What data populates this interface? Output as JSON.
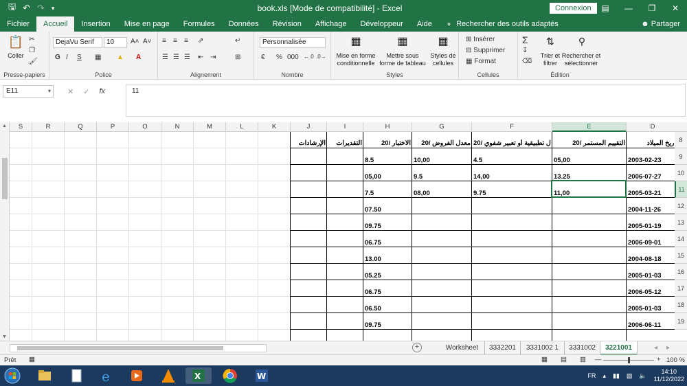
{
  "titlebar": {
    "title": "book.xls  [Mode de compatibilité]  -  Excel",
    "signin": "Connexion"
  },
  "ribbon_tabs": [
    "Fichier",
    "Accueil",
    "Insertion",
    "Mise en page",
    "Formules",
    "Données",
    "Révision",
    "Affichage",
    "Développeur",
    "Aide"
  ],
  "tell_me": "Rechercher des outils adaptés",
  "share": "Partager",
  "ribbon": {
    "clipboard": {
      "paste": "Coller",
      "label": "Presse-papiers"
    },
    "font": {
      "name": "DejaVu Serif",
      "size": "10",
      "label": "Police"
    },
    "alignment": {
      "label": "Alignement"
    },
    "number": {
      "format": "Personnalisée",
      "label": "Nombre"
    },
    "styles": {
      "conditional": "Mise en forme conditionnelle",
      "table": "Mettre sous forme de tableau",
      "cell_styles": "Styles de cellules",
      "label": "Styles"
    },
    "cells": {
      "insert": "Insérer",
      "delete": "Supprimer",
      "format": "Format",
      "label": "Cellules"
    },
    "editing": {
      "sort": "Trier et filtrer",
      "find": "Rechercher et sélectionner",
      "label": "Édition"
    }
  },
  "formula_bar": {
    "name_box": "E11",
    "value": "11"
  },
  "columns": [
    "S",
    "R",
    "Q",
    "P",
    "O",
    "N",
    "M",
    "L",
    "K",
    "J",
    "I",
    "H",
    "G",
    "F",
    "E",
    "D"
  ],
  "rows": [
    "8",
    "9",
    "10",
    "11",
    "12",
    "13",
    "14",
    "15",
    "16",
    "17",
    "18",
    "19"
  ],
  "headers": {
    "D": "تاريخ الميلاد",
    "E": "التقييم المستمر /20",
    "F": "أعمال تطبيقية أو تعبير شفوي /20",
    "G": "معدل الفروض /20",
    "H": "الاختبار /20",
    "I": "التقديرات",
    "J": "الإرشادات"
  },
  "table_rows": [
    {
      "D": "2003-02-23",
      "E": "05,00",
      "F": "4.5",
      "G": "10,00",
      "H": "8.5"
    },
    {
      "D": "2006-07-27",
      "E": "13.25",
      "F": "14,00",
      "G": "9.5",
      "H": "05,00"
    },
    {
      "D": "2005-03-21",
      "E": "11,00",
      "F": "9.75",
      "G": "08,00",
      "H": "7.5"
    },
    {
      "D": "2004-11-26",
      "E": "",
      "F": "",
      "G": "",
      "H": "07.50"
    },
    {
      "D": "2005-01-19",
      "E": "",
      "F": "",
      "G": "",
      "H": "09.75"
    },
    {
      "D": "2006-09-01",
      "E": "",
      "F": "",
      "G": "",
      "H": "06.75"
    },
    {
      "D": "2004-08-18",
      "E": "",
      "F": "",
      "G": "",
      "H": "13.00"
    },
    {
      "D": "2005-01-03",
      "E": "",
      "F": "",
      "G": "",
      "H": "05.25"
    },
    {
      "D": "2006-05-12",
      "E": "",
      "F": "",
      "G": "",
      "H": "06.75"
    },
    {
      "D": "2005-01-03",
      "E": "",
      "F": "",
      "G": "",
      "H": "06.50"
    },
    {
      "D": "2006-06-11",
      "E": "",
      "F": "",
      "G": "",
      "H": "09.75"
    }
  ],
  "sheets": [
    "Worksheet",
    "3332201",
    "3331002 1",
    "3331002",
    "3221001"
  ],
  "active_sheet": "3221001",
  "status": {
    "mode": "Prêt",
    "zoom": "100 %"
  },
  "taskbar": {
    "lang": "FR",
    "time": "14:10",
    "date": "11/12/2022"
  },
  "colors": {
    "excel_green": "#217346",
    "taskbar": "#1c3a5e"
  }
}
